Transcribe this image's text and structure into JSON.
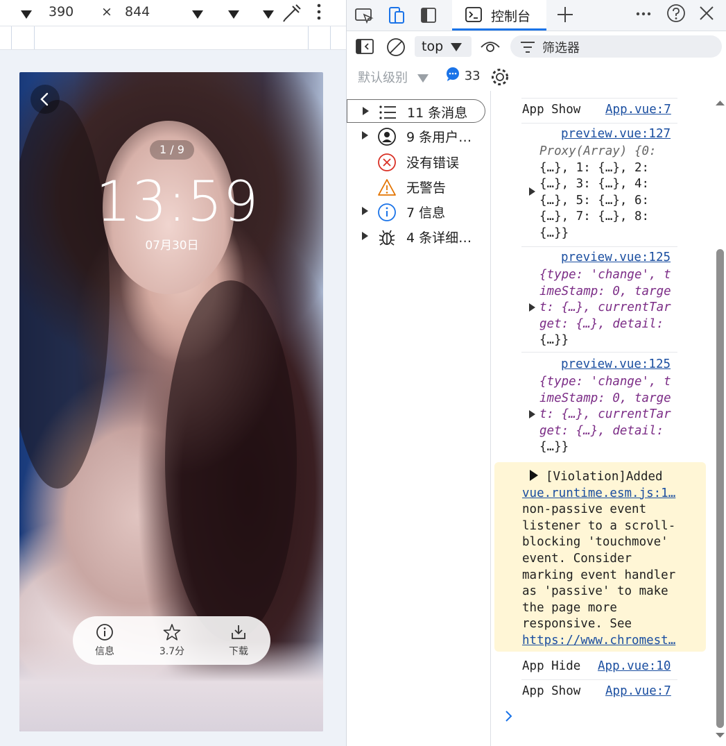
{
  "device_toolbar": {
    "width": "390",
    "times": "×",
    "height": "844"
  },
  "phone": {
    "pager": "1 / 9",
    "time": "13:59",
    "date": "07月30日",
    "actions": [
      {
        "icon": "info-icon",
        "label": "信息"
      },
      {
        "icon": "star-icon",
        "label": "3.7分"
      },
      {
        "icon": "download-icon",
        "label": "下载"
      }
    ]
  },
  "devtools": {
    "active_tab": "控制台",
    "context": "top",
    "filter_placeholder": "筛选器",
    "levels": "默认级别",
    "message_count": "33",
    "sidebar": [
      {
        "icon": "list-icon",
        "label": "11 条消息",
        "expandable": true
      },
      {
        "icon": "user-icon",
        "label": "9 条用户…",
        "expandable": true
      },
      {
        "icon": "error-icon",
        "label": "没有错误",
        "expandable": false
      },
      {
        "icon": "warning-icon",
        "label": "无警告",
        "expandable": false
      },
      {
        "icon": "info-icon",
        "label": "7 信息",
        "expandable": true
      },
      {
        "icon": "bug-icon",
        "label": "4 条详细…",
        "expandable": true
      }
    ],
    "console": {
      "msg1_text": "App Show",
      "msg1_src": "App.vue:7",
      "msg2_src": "preview.vue:127",
      "msg3_src": "preview.vue:125",
      "msg4_src": "preview.vue:125",
      "violation_src": "vue.runtime.esm.js:1…",
      "violation_link": "https://www.chromest…",
      "msg5_text": "App Hide",
      "msg5_src": "App.vue:10",
      "msg6_text": "App Show",
      "msg6_src": "App.vue:7",
      "proxy_lines": [
        "Proxy(Array) {0:",
        "{…}, 1: {…}, 2:",
        "{…}, 3: {…}, 4:",
        "{…}, 5: {…}, 6:",
        "{…}, 7: {…}, 8:",
        "{…}}"
      ],
      "event_lines": [
        "{type: 'change', t",
        "imeStamp: 0, targe",
        "t: {…}, currentTar",
        "get: {…}, detail:",
        "{…}}"
      ],
      "violation_lines": [
        "[Violation]Added",
        "non-passive event",
        "listener to a scroll-",
        "blocking 'touchmove'",
        "event. Consider",
        "marking event handler",
        "as 'passive' to make",
        "the page more",
        "responsive. See"
      ]
    }
  },
  "colors": {
    "accent": "#1a73e8",
    "violation_bg": "#fff6d6",
    "error": "#d93025",
    "warning": "#e37400"
  }
}
